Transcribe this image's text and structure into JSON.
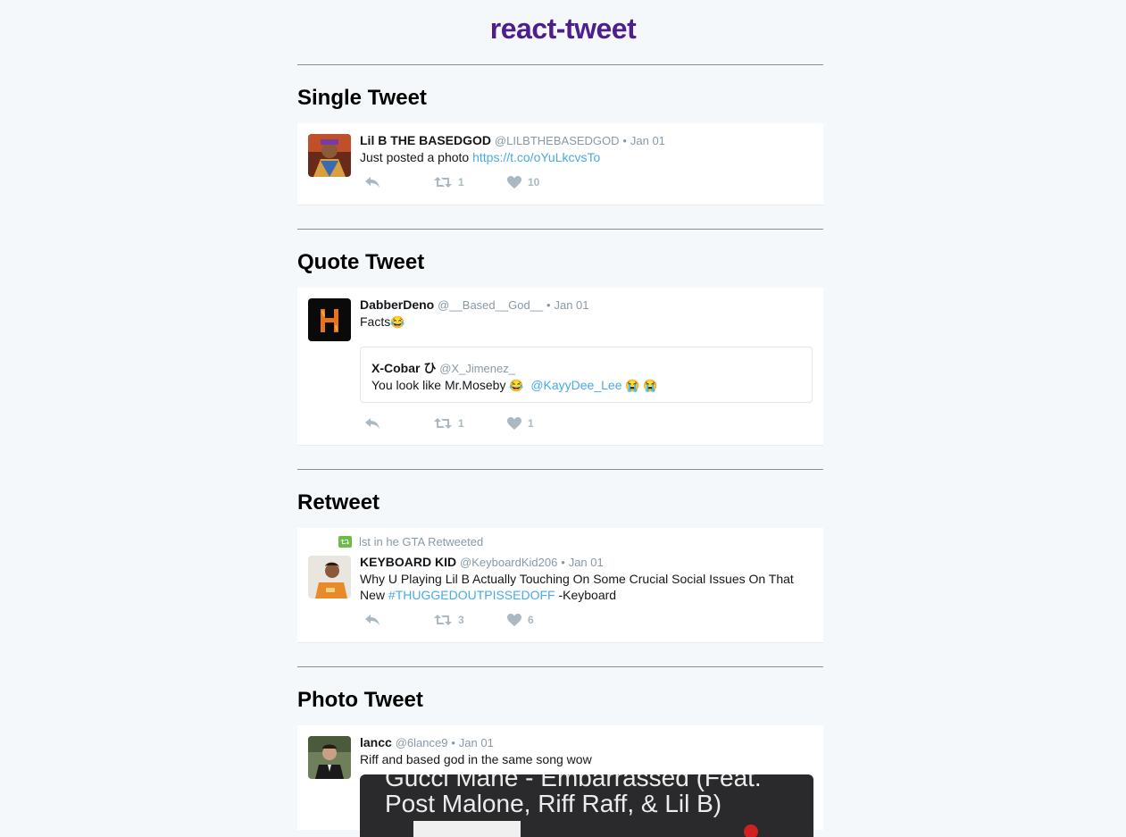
{
  "app": {
    "title": "react-tweet"
  },
  "sections": [
    {
      "heading": "Single Tweet",
      "tweet": {
        "name": "Lil B THE BASEDGOD",
        "handle": "@LILBTHEBASEDGOD",
        "separator": "•",
        "date": "Jan 01",
        "text": "Just posted a photo ",
        "link": "https://t.co/oYuLkcvsTo",
        "retweets": "1",
        "likes": "10"
      }
    },
    {
      "heading": "Quote Tweet",
      "tweet": {
        "name": "DabberDeno",
        "handle": "@__Based__God__",
        "separator": "•",
        "date": "Jan 01",
        "text": "Facts",
        "emoji": "😂",
        "retweets": "1",
        "likes": "1",
        "quoted": {
          "name": "X-Cobar ひ",
          "handle": "@X_Jimenez_",
          "text": "You look like Mr.Moseby ",
          "emoji1": "😂",
          "mention": "@KayyDee_Lee",
          "emoji2": "😭 😭"
        }
      }
    },
    {
      "heading": "Retweet",
      "tweet": {
        "retweeted_by": "lst in he GTA Retweeted",
        "name": "KEYBOARD KID",
        "handle": "@KeyboardKid206",
        "separator": "•",
        "date": "Jan 01",
        "text1": "Why U Playing Lil B Actually Touching On Some Crucial Social Issues On That",
        "text2_prefix": "New ",
        "hashtag": "#THUGGEDOUTPISSEDOFF",
        "text2_suffix": " -Keyboard",
        "retweets": "3",
        "likes": "6"
      }
    },
    {
      "heading": "Photo Tweet",
      "tweet": {
        "name": "lancc",
        "handle": "@6lance9",
        "separator": "•",
        "date": "Jan 01",
        "text": "Riff and based god in the same song wow",
        "photo_text1": "Gucci Mane - Embarrassed (Feat.",
        "photo_text2": "Post Malone, Riff Raff, & Lil B)"
      }
    }
  ],
  "colors": {
    "background": "#f5f8fa",
    "title": "#4d1f8c",
    "link": "#48aae6",
    "muted": "#8899a6",
    "action": "#aab8c2",
    "retweet_badge": "#6cbd45"
  },
  "icons": [
    "reply-icon",
    "retweet-icon",
    "like-icon"
  ]
}
